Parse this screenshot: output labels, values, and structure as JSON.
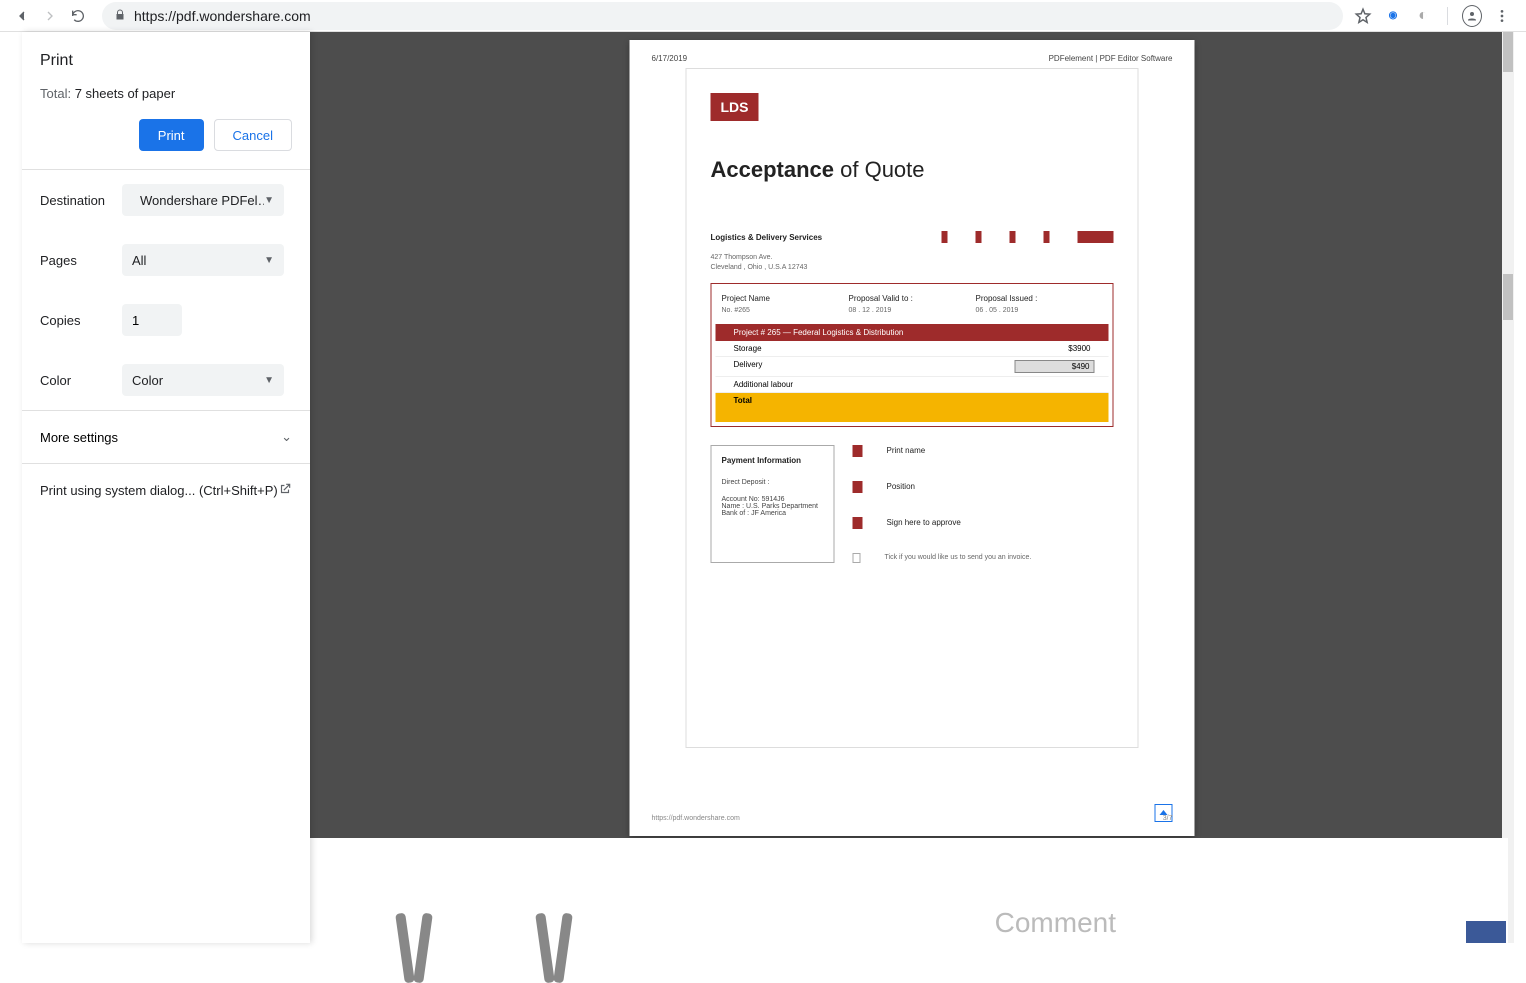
{
  "browser": {
    "url": "https://pdf.wondershare.com"
  },
  "print": {
    "title": "Print",
    "total_prefix": "Total: ",
    "total_value": "7 sheets of paper",
    "print_btn": "Print",
    "cancel_btn": "Cancel",
    "destination_label": "Destination",
    "destination_value": "Wondershare PDFel…",
    "pages_label": "Pages",
    "pages_value": "All",
    "copies_label": "Copies",
    "copies_value": "1",
    "color_label": "Color",
    "color_value": "Color",
    "more_settings": "More settings",
    "system_dialog": "Print using system dialog... (Ctrl+Shift+P)"
  },
  "doc": {
    "page_date": "6/17/2019",
    "page_header_right": "PDFelement | PDF Editor Software",
    "logo": "LDS",
    "title_bold": "Acceptance",
    "title_rest": " of Quote",
    "company": "Logistics & Delivery Services",
    "addr1": "427 Thompson Ave.",
    "addr2": "Cleveland , Ohio , U.S.A 12743",
    "meta": {
      "h1": "Project Name",
      "h2": "Proposal Valid to :",
      "h3": "Proposal Issued :",
      "v1": "No. #265",
      "v2": "08 . 12 . 2019",
      "v3": "06 . 05 . 2019"
    },
    "project_bar": "Project # 265 — Federal Logistics & Distribution",
    "rows": {
      "r1_label": "Storage",
      "r1_val": "$3900",
      "r2_label": "Delivery",
      "r2_val": "$490",
      "r3_label": "Additional labour",
      "total_label": "Total"
    },
    "payment": {
      "header": "Payment Information",
      "dd": "Direct Deposit :",
      "acct": "Account No: 5914J6",
      "name": "Name :  U.S. Parks Department",
      "bank": "Bank of :  JF America"
    },
    "sign": {
      "s1": "Print name",
      "s2": "Position",
      "s3": "Sign here to approve",
      "s4": "Tick if you would like us to send you an invoice."
    },
    "footer_url": "https://pdf.wondershare.com",
    "footer_page": "3/7"
  },
  "bottom": {
    "comment": "Comment"
  }
}
